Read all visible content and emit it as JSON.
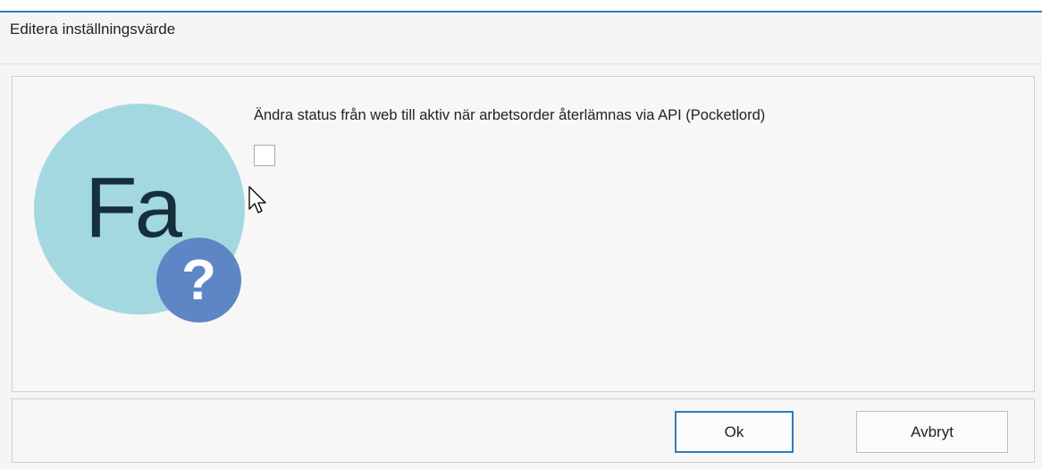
{
  "dialog": {
    "title": "Editera inställningsvärde"
  },
  "avatar": {
    "initials": "Fa",
    "help_glyph": "?",
    "icon": "question-mark-badge-icon",
    "colors": {
      "circle": "#a4d8e0",
      "badge": "#5f86c4"
    }
  },
  "setting": {
    "label": "Ändra status från web till aktiv när arbetsorder återlämnas via API (Pocketlord)",
    "checked": false
  },
  "buttons": {
    "ok": "Ok",
    "cancel": "Avbryt"
  },
  "colors": {
    "accent": "#2b7cc4"
  }
}
